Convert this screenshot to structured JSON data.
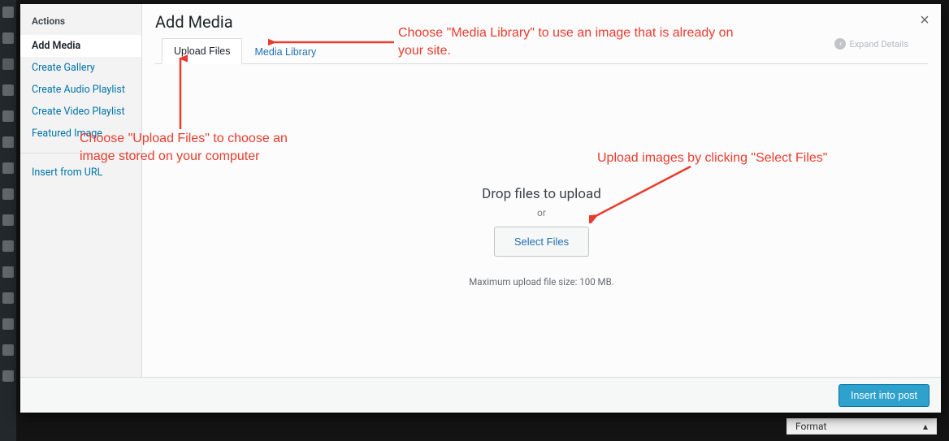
{
  "sidebar": {
    "heading": "Actions",
    "items": [
      {
        "label": "Add Media",
        "active": true
      },
      {
        "label": "Create Gallery",
        "active": false
      },
      {
        "label": "Create Audio Playlist",
        "active": false
      },
      {
        "label": "Create Video Playlist",
        "active": false
      },
      {
        "label": "Featured Image",
        "active": false
      }
    ],
    "secondary": [
      {
        "label": "Insert from URL"
      }
    ]
  },
  "header": {
    "title": "Add Media",
    "expand_label": "Expand Details"
  },
  "tabs": [
    {
      "label": "Upload Files",
      "active": true
    },
    {
      "label": "Media Library",
      "active": false
    }
  ],
  "upload": {
    "drop_label": "Drop files to upload",
    "or_label": "or",
    "select_button": "Select Files",
    "max_size_label": "Maximum upload file size: 100 MB."
  },
  "footer": {
    "insert_button": "Insert into post"
  },
  "background": {
    "panel_label": "Format"
  },
  "annotations": {
    "a1": "Choose \"Media Library\" to use an image that is already on your site.",
    "a2": "Choose \"Upload Files\" to choose an image stored on your computer",
    "a3": "Upload images by clicking \"Select Files\""
  }
}
